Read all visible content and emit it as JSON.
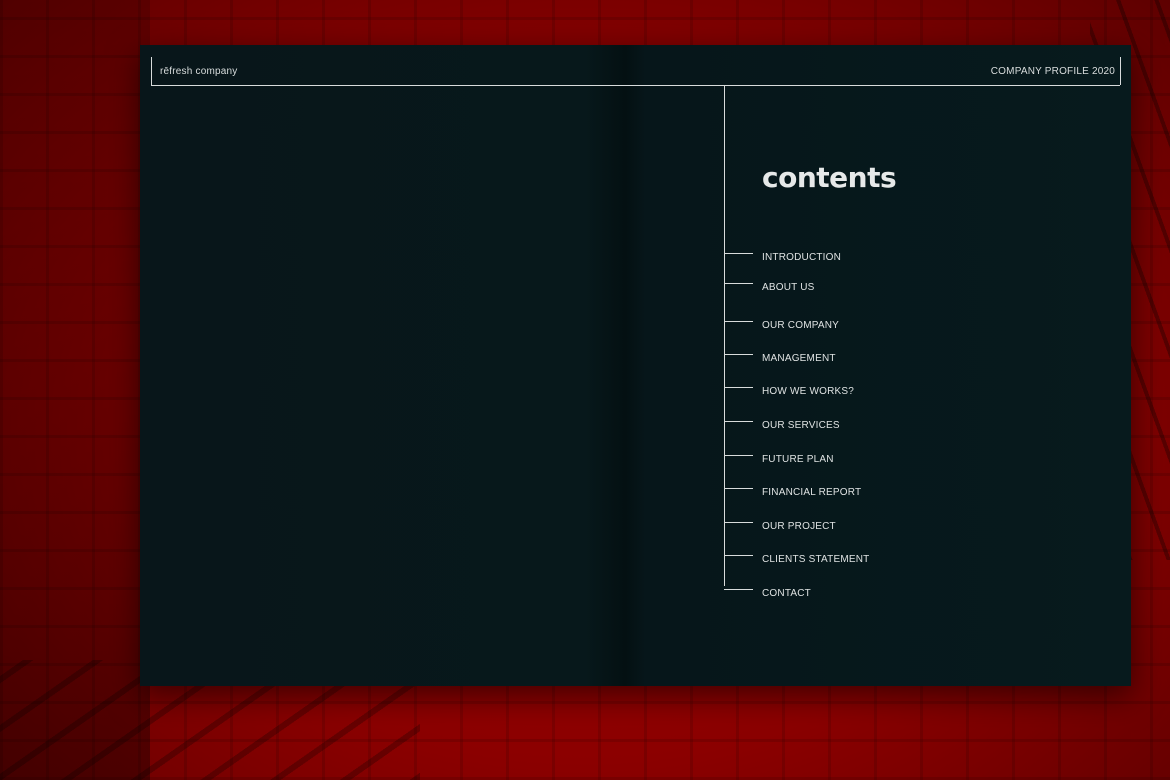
{
  "header": {
    "brand": "rēfresh company",
    "profile": "COMPANY PROFILE 2020"
  },
  "contents": {
    "title": "contents",
    "items": [
      {
        "label": "INTRODUCTION"
      },
      {
        "label": "ABOUT US"
      },
      {
        "label": "OUR COMPANY"
      },
      {
        "label": "MANAGEMENT"
      },
      {
        "label": "HOW WE WORKS?"
      },
      {
        "label": "OUR SERVICES"
      },
      {
        "label": "FUTURE PLAN"
      },
      {
        "label": "FINANCIAL REPORT"
      },
      {
        "label": "OUR PROJECT"
      },
      {
        "label": "CLIENTS STATEMENT"
      },
      {
        "label": "CONTACT"
      }
    ]
  },
  "colors": {
    "background_red": "#8b0000",
    "page_dark": "#07181b",
    "line": "#d8dcdc",
    "text": "#dfe3e3"
  }
}
